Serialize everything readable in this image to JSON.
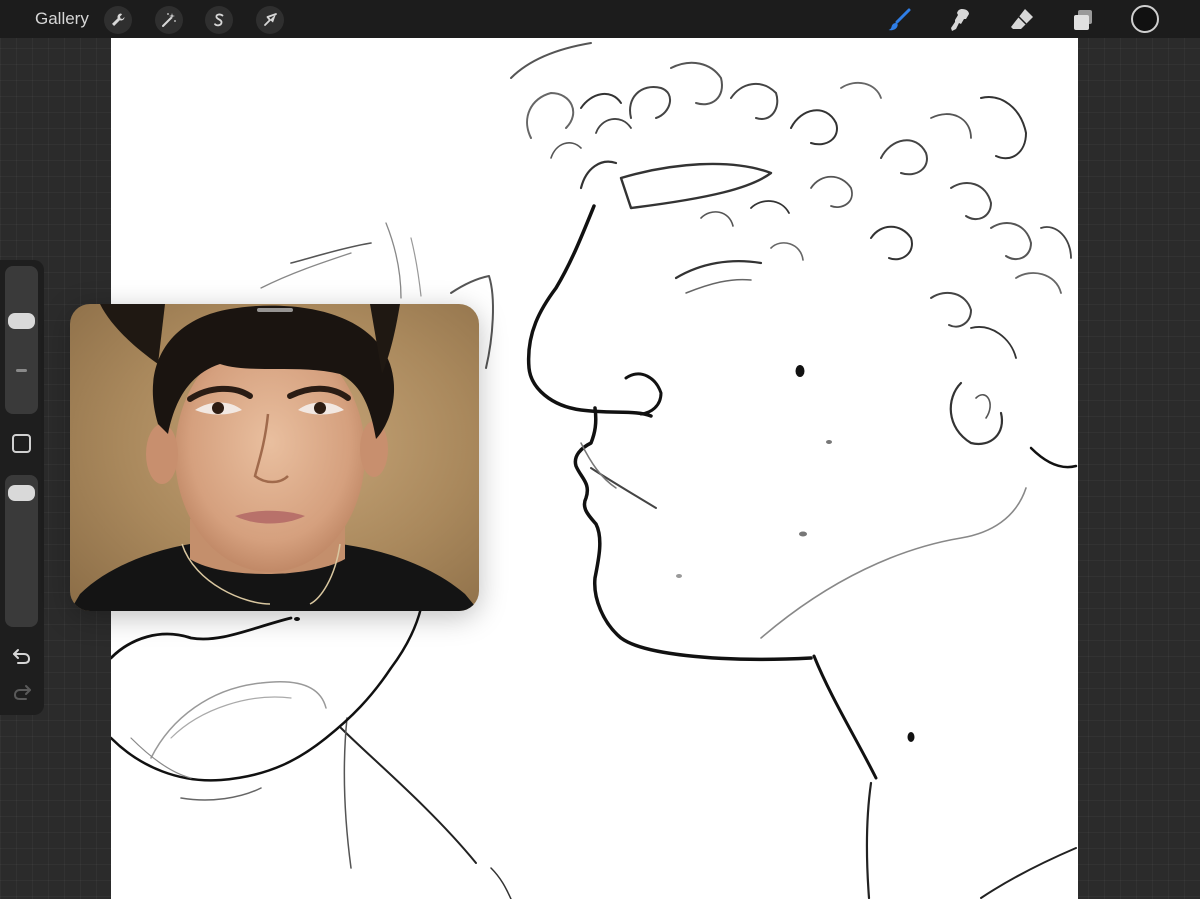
{
  "toolbar": {
    "gallery_label": "Gallery",
    "left_tools": [
      {
        "name": "actions",
        "icon": "wrench-icon"
      },
      {
        "name": "adjustments",
        "icon": "magic-wand-icon"
      },
      {
        "name": "selection",
        "icon": "selection-s-icon"
      },
      {
        "name": "transform",
        "icon": "arrow-cursor-icon"
      }
    ],
    "right_tools": [
      {
        "name": "brush",
        "icon": "brush-icon",
        "active": true
      },
      {
        "name": "smudge",
        "icon": "smudge-icon"
      },
      {
        "name": "eraser",
        "icon": "eraser-icon"
      },
      {
        "name": "layers",
        "icon": "layers-icon"
      }
    ],
    "active_color": "#111111",
    "accent_color": "#2f7ee6"
  },
  "sidebar": {
    "brush_size_level": 0.35,
    "opacity_level": 0.05,
    "modify_icon": "square-icon",
    "undo_icon": "undo-icon",
    "redo_icon": "redo-icon"
  },
  "reference": {
    "icon": "reference-photo",
    "subject": "portrait-photo"
  }
}
